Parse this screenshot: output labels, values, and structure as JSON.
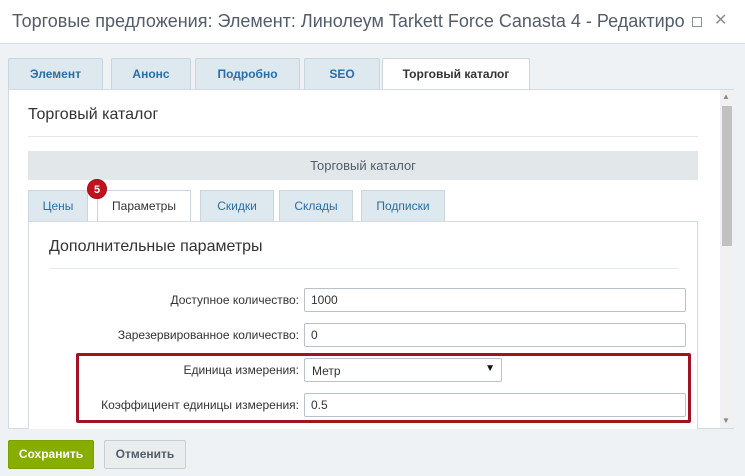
{
  "window": {
    "title": "Торговые предложения: Элемент: Линолеум Tarkett Force Canasta 4 - Редактиро"
  },
  "top_tabs": [
    {
      "label": "Элемент"
    },
    {
      "label": "Анонс"
    },
    {
      "label": "Подробно"
    },
    {
      "label": "SEO"
    },
    {
      "label": "Торговый каталог"
    }
  ],
  "panel": {
    "title": "Торговый каталог",
    "section_bar": "Торговый каталог"
  },
  "sub_tabs": [
    {
      "label": "Цены"
    },
    {
      "label": "Параметры"
    },
    {
      "label": "Скидки"
    },
    {
      "label": "Склады"
    },
    {
      "label": "Подписки"
    }
  ],
  "badge": "5",
  "params": {
    "title": "Дополнительные параметры",
    "available_label": "Доступное количество:",
    "available_value": "1000",
    "reserved_label": "Зарезервированное количество:",
    "reserved_value": "0",
    "unit_label": "Единица измерения:",
    "unit_value": "Метр",
    "ratio_label": "Коэффициент единицы измерения:",
    "ratio_value": "0.5"
  },
  "footer": {
    "save_label": "Сохранить",
    "cancel_label": "Отменить"
  },
  "colors": {
    "save_button": "#86ad00",
    "highlight_border": "#a21321",
    "badge": "#c0131d",
    "tab_link": "#2a6ea8"
  }
}
